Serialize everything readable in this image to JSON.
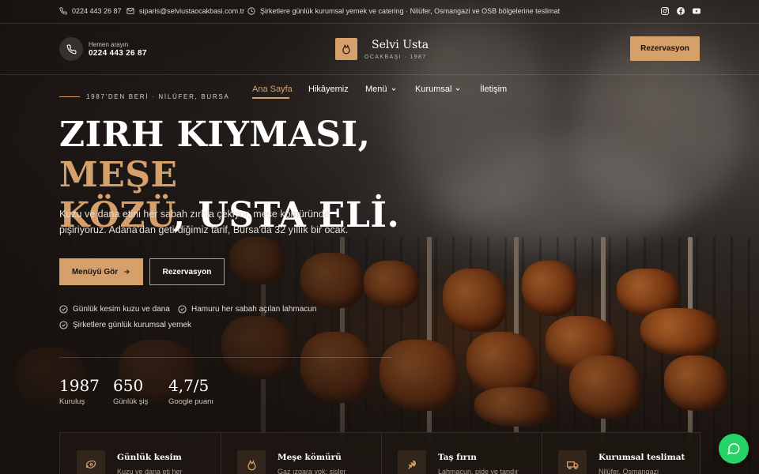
{
  "topbar": {
    "phone": "0224 443 26 87",
    "email": "siparis@selviustaocakbasi.com.tr",
    "notice": "Şirketlere günlük kurumsal yemek ve catering · Nilüfer, Osmangazi ve OSB bölgelerine teslimat",
    "social": [
      "instagram-icon",
      "facebook-icon",
      "youtube-icon"
    ]
  },
  "header": {
    "call_label": "Hemen arayın",
    "call_number": "0224 443 26 87",
    "brand_name": "Selvi Usta",
    "brand_sub": "OCAKBAŞI · 1987",
    "reservation_button": "Rezervasyon"
  },
  "nav": {
    "eyebrow": "1987'DEN BERİ · NİLÜFER, BURSA",
    "items": [
      {
        "label": "Ana Sayfa",
        "active": true
      },
      {
        "label": "Hikâyemiz"
      },
      {
        "label": "Menü",
        "dropdown": true
      },
      {
        "label": "Kurumsal",
        "dropdown": true
      },
      {
        "label": "İletişim"
      }
    ]
  },
  "hero": {
    "title_part1": "ZIRH KIYMASI, ",
    "title_accent1": "MEŞE",
    "title_accent2": "KÖZÜ",
    "title_part2": ", USTA ELİ.",
    "description": "Kuzu ve dana etini her sabah zırhla çekiyor, meşe kömüründe pişiriyoruz. Adana'dan getirdiğimiz tarif, Bursa'da 32 yıllık bir ocak.",
    "menu_button": "Menüyü Gör",
    "reservation_button": "Rezervasyon",
    "features": [
      "Günlük kesim kuzu ve dana",
      "Hamuru her sabah açılan lahmacun",
      "Şirketlere günlük kurumsal yemek"
    ]
  },
  "stats": [
    {
      "value": "1987",
      "label": "Kuruluş"
    },
    {
      "value": "650",
      "label": "Günlük şiş"
    },
    {
      "value": "4,7/5",
      "label": "Google puanı"
    }
  ],
  "cards": [
    {
      "title": "Günlük kesim",
      "text": "Kuzu ve dana eti her",
      "icon": "meat-icon"
    },
    {
      "title": "Meşe kömürü",
      "text": "Gaz ızgara yok; şişler",
      "icon": "flame-icon"
    },
    {
      "title": "Taş fırın",
      "text": "Lahmacun, pide ve tandır",
      "icon": "wheat-icon"
    },
    {
      "title": "Kurumsal teslimat",
      "text": "Nilüfer, Osmangazi",
      "icon": "truck-icon"
    }
  ],
  "colors": {
    "accent": "#d6a06a",
    "dark": "#1c140f",
    "whatsapp": "#25d366"
  }
}
